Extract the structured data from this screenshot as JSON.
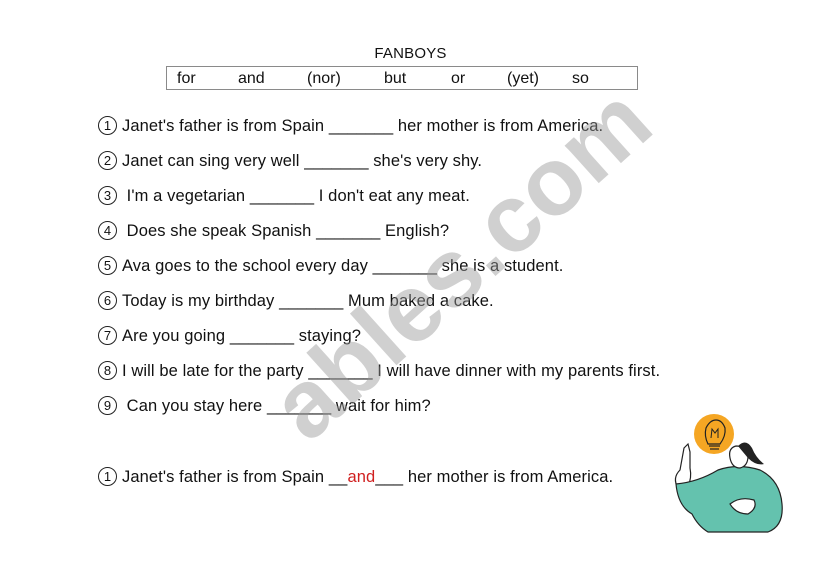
{
  "title": "FANBOYS",
  "conjunctions": [
    "for",
    "and",
    "(nor)",
    "but",
    "or",
    "(yet)",
    "so"
  ],
  "questions": [
    {
      "num": "1",
      "before": "Janet's father is from Spain",
      "blank": "_______",
      "after": "her mother is from America."
    },
    {
      "num": "2",
      "before": "Janet can sing very well",
      "blank": "_______",
      "after": "she's very shy."
    },
    {
      "num": "3",
      "before": " I'm a vegetarian",
      "blank": "_______",
      "after": "I don't eat any meat."
    },
    {
      "num": "4",
      "before": " Does she speak Spanish",
      "blank": "_______",
      "after": "English?"
    },
    {
      "num": "5",
      "before": "Ava goes to the school every day",
      "blank": "_______",
      "after": "she is a student."
    },
    {
      "num": "6",
      "before": "Today is my birthday",
      "blank": "_______",
      "after": "Mum baked a cake."
    },
    {
      "num": "7",
      "before": "Are you going",
      "blank": "_______",
      "after": "staying?"
    },
    {
      "num": "8",
      "before": "I will be late for the party",
      "blank": "_______",
      "after": "I will have dinner with my parents first."
    },
    {
      "num": "9",
      "before": " Can you stay here",
      "blank": "_______",
      "after": "wait for him?"
    }
  ],
  "example": {
    "num": "1",
    "before": "Janet's father is from Spain",
    "blank_left": "__",
    "answer": "and",
    "blank_right": "___",
    "after": "her mother is from America.",
    "answer_color": "#d01f1f"
  },
  "watermark": "ables.com"
}
